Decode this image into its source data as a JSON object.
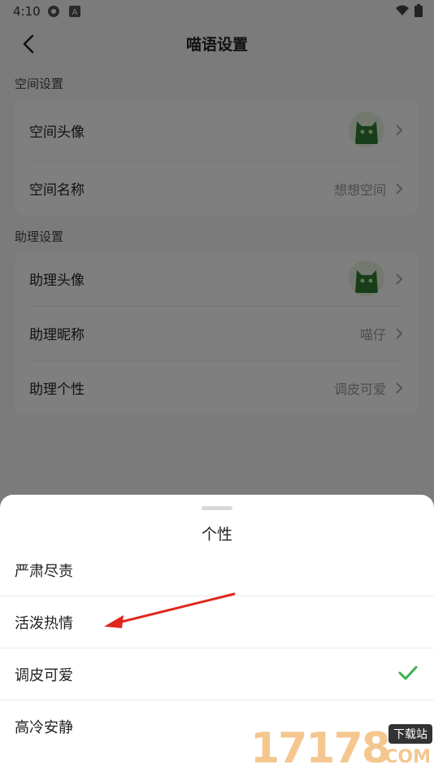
{
  "status_bar": {
    "time": "4:10"
  },
  "header": {
    "title": "喵语设置"
  },
  "space_section": {
    "label": "空间设置",
    "avatar_label": "空间头像",
    "name_label": "空间名称",
    "name_value": "想想空间"
  },
  "assistant_section": {
    "label": "助理设置",
    "avatar_label": "助理头像",
    "nickname_label": "助理昵称",
    "nickname_value": "喵仔",
    "personality_label": "助理个性",
    "personality_value": "调皮可爱"
  },
  "sheet": {
    "title": "个性",
    "options": [
      {
        "label": "严肃尽责",
        "selected": false
      },
      {
        "label": "活泼热情",
        "selected": false
      },
      {
        "label": "调皮可爱",
        "selected": true
      },
      {
        "label": "高冷安静",
        "selected": false
      }
    ]
  },
  "watermark": {
    "digits": "17178",
    "badge": "下载站",
    "suffix": ".COM"
  },
  "colors": {
    "check": "#3cb054",
    "annotation_arrow": "#e0261b"
  },
  "icons": [
    "back-arrow-icon",
    "chevron-right-icon",
    "checkmark-icon",
    "wifi-icon",
    "battery-icon",
    "cat-avatar-icon"
  ]
}
